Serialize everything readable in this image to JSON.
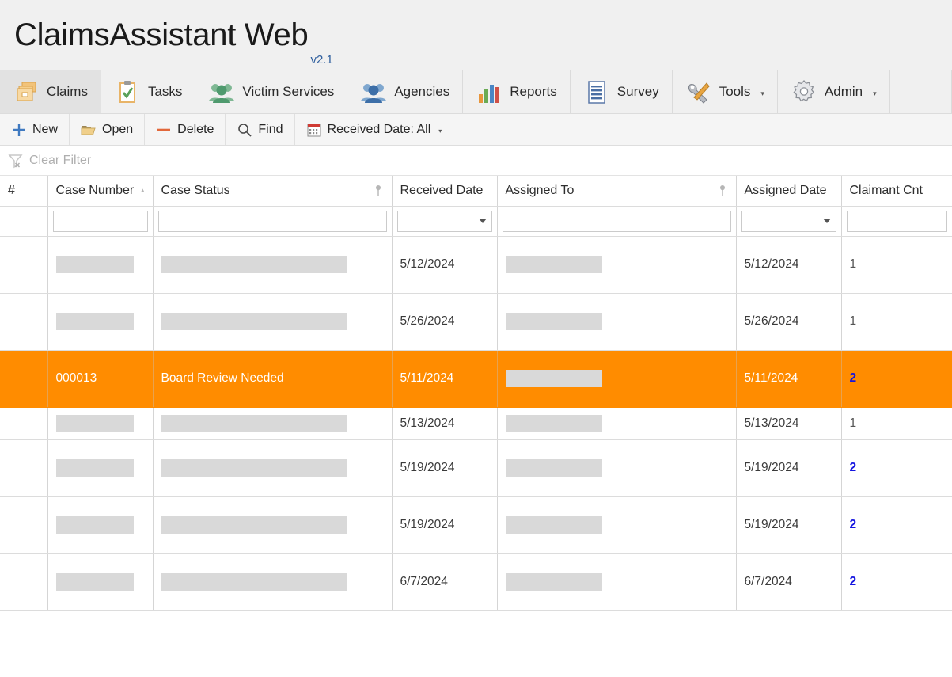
{
  "app": {
    "title": "ClaimsAssistant Web",
    "version": "v2.1"
  },
  "ribbon": {
    "tabs": [
      {
        "label": "Claims",
        "icon": "stacked-boxes-icon",
        "active": true,
        "caret": ""
      },
      {
        "label": "Tasks",
        "icon": "clipboard-check-icon",
        "active": false,
        "caret": ""
      },
      {
        "label": "Victim Services",
        "icon": "people-green-icon",
        "active": false,
        "caret": ""
      },
      {
        "label": "Agencies",
        "icon": "people-blue-icon",
        "active": false,
        "caret": ""
      },
      {
        "label": "Reports",
        "icon": "bar-chart-icon",
        "active": false,
        "caret": ""
      },
      {
        "label": "Survey",
        "icon": "document-lines-icon",
        "active": false,
        "caret": ""
      },
      {
        "label": "Tools",
        "icon": "wrench-hammer-icon",
        "active": false,
        "caret": "▾"
      },
      {
        "label": "Admin",
        "icon": "gear-icon",
        "active": false,
        "caret": "▾"
      }
    ]
  },
  "toolbar": {
    "buttons": [
      {
        "label": "New",
        "icon": "plus-icon",
        "caret": ""
      },
      {
        "label": "Open",
        "icon": "folder-icon",
        "caret": ""
      },
      {
        "label": "Delete",
        "icon": "minus-icon",
        "caret": ""
      },
      {
        "label": "Find",
        "icon": "search-icon",
        "caret": ""
      },
      {
        "label": "Received Date: All",
        "icon": "calendar-icon",
        "caret": "▾"
      }
    ]
  },
  "filter_bar": {
    "clear_filter_label": "Clear Filter",
    "clear_filter_icon": "funnel-clear-icon",
    "enabled": false
  },
  "grid": {
    "columns": [
      {
        "key": "rownum",
        "label": "#",
        "filter": "none",
        "pin": false,
        "sort": ""
      },
      {
        "key": "case_no",
        "label": "Case Number",
        "filter": "text",
        "pin": false,
        "sort": "▴"
      },
      {
        "key": "status",
        "label": "Case Status",
        "filter": "text",
        "pin": true,
        "sort": ""
      },
      {
        "key": "recv_date",
        "label": "Received Date",
        "filter": "dropdown",
        "pin": false,
        "sort": ""
      },
      {
        "key": "assigned",
        "label": "Assigned To",
        "filter": "text",
        "pin": true,
        "sort": ""
      },
      {
        "key": "asgn_date",
        "label": "Assigned Date",
        "filter": "dropdown",
        "pin": false,
        "sort": ""
      },
      {
        "key": "claimants",
        "label": "Claimant Cnt",
        "filter": "text",
        "pin": false,
        "sort": ""
      }
    ],
    "filter_values": {
      "case_no": "",
      "status": "",
      "recv_date": "",
      "assigned": "",
      "asgn_date": "",
      "claimants": ""
    },
    "rows": [
      {
        "rownum": "",
        "case_no": "",
        "case_no_redacted": true,
        "status": "",
        "status_redacted": true,
        "recv_date": "5/12/2024",
        "assigned": "",
        "assigned_redacted": true,
        "asgn_date": "5/12/2024",
        "claimants": "1",
        "claimants_highlight": false,
        "selected": false,
        "short": false
      },
      {
        "rownum": "",
        "case_no": "",
        "case_no_redacted": true,
        "status": "",
        "status_redacted": true,
        "recv_date": "5/26/2024",
        "assigned": "",
        "assigned_redacted": true,
        "asgn_date": "5/26/2024",
        "claimants": "1",
        "claimants_highlight": false,
        "selected": false,
        "short": false
      },
      {
        "rownum": "",
        "case_no": "000013",
        "case_no_redacted": false,
        "status": "Board Review Needed",
        "status_redacted": false,
        "recv_date": "5/11/2024",
        "assigned": "",
        "assigned_redacted": true,
        "asgn_date": "5/11/2024",
        "claimants": "2",
        "claimants_highlight": true,
        "selected": true,
        "short": false
      },
      {
        "rownum": "",
        "case_no": "",
        "case_no_redacted": true,
        "status": "",
        "status_redacted": true,
        "recv_date": "5/13/2024",
        "assigned": "",
        "assigned_redacted": true,
        "asgn_date": "5/13/2024",
        "claimants": "1",
        "claimants_highlight": false,
        "selected": false,
        "short": true
      },
      {
        "rownum": "",
        "case_no": "",
        "case_no_redacted": true,
        "status": "",
        "status_redacted": true,
        "recv_date": "5/19/2024",
        "assigned": "",
        "assigned_redacted": true,
        "asgn_date": "5/19/2024",
        "claimants": "2",
        "claimants_highlight": true,
        "selected": false,
        "short": false
      },
      {
        "rownum": "",
        "case_no": "",
        "case_no_redacted": true,
        "status": "",
        "status_redacted": true,
        "recv_date": "5/19/2024",
        "assigned": "",
        "assigned_redacted": true,
        "asgn_date": "5/19/2024",
        "claimants": "2",
        "claimants_highlight": true,
        "selected": false,
        "short": false
      },
      {
        "rownum": "",
        "case_no": "",
        "case_no_redacted": true,
        "status": "",
        "status_redacted": true,
        "recv_date": "6/7/2024",
        "assigned": "",
        "assigned_redacted": true,
        "asgn_date": "6/7/2024",
        "claimants": "2",
        "claimants_highlight": true,
        "selected": false,
        "short": false
      }
    ]
  },
  "colors": {
    "selection_orange": "#ff8c00",
    "count_blue": "#1414e0",
    "version_blue": "#2f5f9e",
    "chrome_gray": "#f0f0f0",
    "redaction_gray": "#d9d9d9"
  }
}
